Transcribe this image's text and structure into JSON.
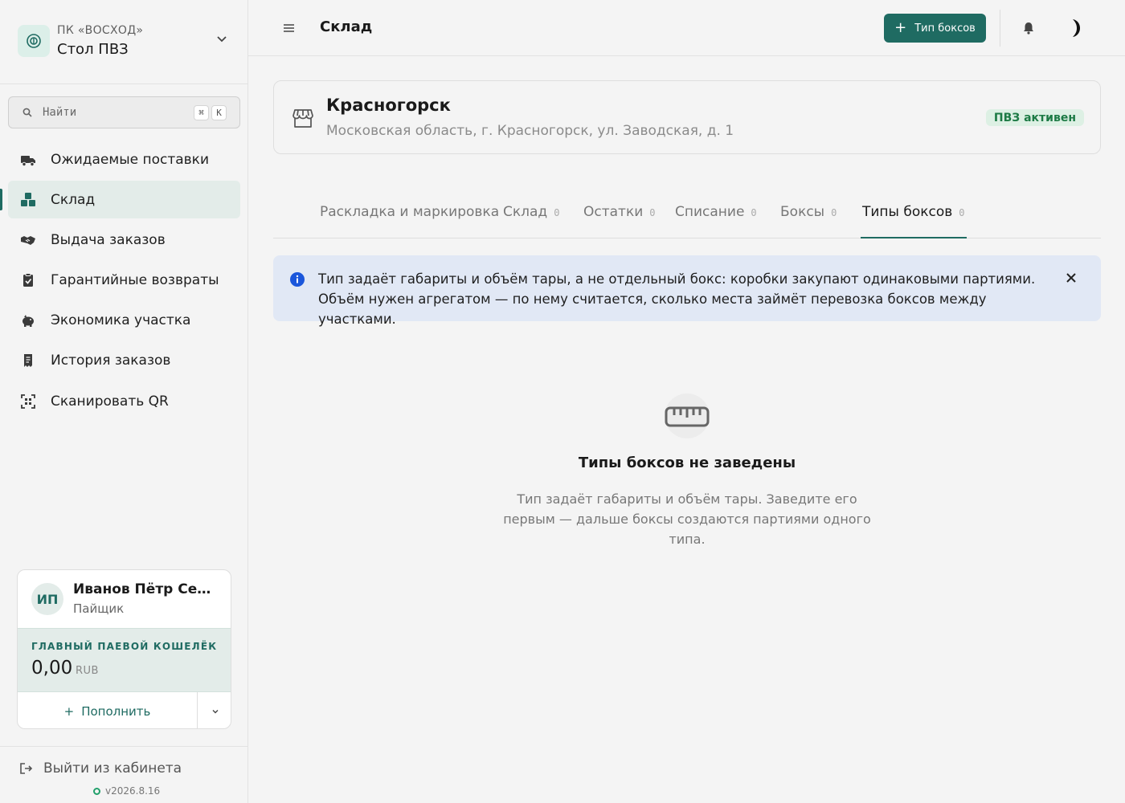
{
  "org": {
    "company": "ПК «ВОСХОД»",
    "name": "Стол ПВЗ"
  },
  "search": {
    "placeholder": "Найти",
    "shortcut_mod": "⌘",
    "shortcut_key": "K"
  },
  "nav": {
    "items": [
      {
        "label": "Ожидаемые поставки",
        "icon": "truck-icon"
      },
      {
        "label": "Склад",
        "icon": "boxes-icon",
        "active": true
      },
      {
        "label": "Выдача заказов",
        "icon": "handshake-icon"
      },
      {
        "label": "Гарантийные возвраты",
        "icon": "clipboard-check-icon"
      },
      {
        "label": "Экономика участка",
        "icon": "piggy-bank-icon"
      },
      {
        "label": "История заказов",
        "icon": "receipt-icon"
      },
      {
        "label": "Сканировать QR",
        "icon": "qr-scan-icon"
      }
    ]
  },
  "user": {
    "initials": "ИП",
    "name": "Иванов Пётр Сергеевич",
    "role": "Пайщик",
    "wallet_label": "ГЛАВНЫЙ ПАЕВОЙ КОШЕЛЁК",
    "wallet_amount": "0,00",
    "wallet_currency": "RUB",
    "topup_label": "Пополнить"
  },
  "footer": {
    "logout_label": "Выйти из кабинета",
    "version": "v2026.8.16"
  },
  "header": {
    "title": "Склад",
    "primary_action": "Тип боксов"
  },
  "location": {
    "name": "Красногорск",
    "address": "Московская область, г. Красногорск, ул. Заводская, д. 1",
    "status": "ПВЗ активен"
  },
  "tabs": [
    {
      "label": "Раскладка и маркировка",
      "count": ""
    },
    {
      "label": "Склад",
      "count": "0"
    },
    {
      "label": "Остатки",
      "count": "0"
    },
    {
      "label": "Списание",
      "count": "0"
    },
    {
      "label": "Боксы",
      "count": "0"
    },
    {
      "label": "Типы боксов",
      "count": "0",
      "active": true
    }
  ],
  "alert": {
    "text": "Тип задаёт габариты и объём тары, а не отдельный бокс: коробки закупают одинаковыми партиями. Объём нужен агрегатом — по нему считается, сколько места займёт перевозка боксов между участками."
  },
  "empty_state": {
    "title": "Типы боксов не заведены",
    "text": "Тип задаёт габариты и объём тары. Заведите его первым — дальше боксы создаются партиями одного типа."
  },
  "colors": {
    "accent": "#1f6b62",
    "accent_light": "#e3ece9",
    "status_green": "#1d7a45",
    "info_bg": "#e1e8f5",
    "info_icon": "#1a56db"
  }
}
